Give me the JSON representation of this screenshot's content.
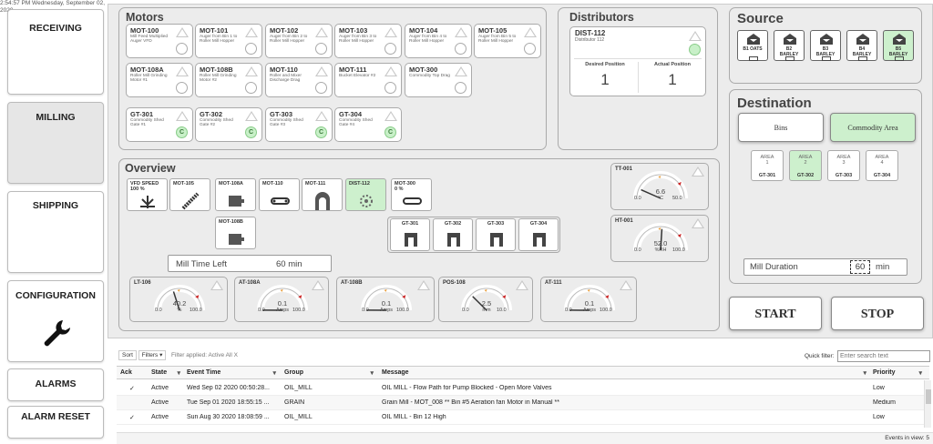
{
  "timestamp": "2:54:57 PM Wednesday, September 02, 2020",
  "nav": {
    "receiving": "RECEIVING",
    "milling": "MILLING",
    "shipping": "SHIPPING",
    "configuration": "CONFIGURATION",
    "alarms": "ALARMS",
    "alarm_reset": "ALARM RESET"
  },
  "motors": {
    "title": "Motors",
    "tiles": [
      {
        "id": "MOT-100",
        "desc": "Mill Feed Multiplied Auger VFD"
      },
      {
        "id": "MOT-101",
        "desc": "Auger from Bin 1 to Roller Mill Hopper"
      },
      {
        "id": "MOT-102",
        "desc": "Auger from Bin 2 to Roller Mill Hopper"
      },
      {
        "id": "MOT-103",
        "desc": "Auger from Bin 3 to Roller Mill Hopper"
      },
      {
        "id": "MOT-104",
        "desc": "Auger from Bin 4 to Roller Mill Hopper"
      },
      {
        "id": "MOT-105",
        "desc": "Auger from Bin 5 to Roller Mill Hopper"
      },
      {
        "id": "MOT-108A",
        "desc": "Roller Mill Grinding Motor #1"
      },
      {
        "id": "MOT-108B",
        "desc": "Roller Mill Grinding Motor #2"
      },
      {
        "id": "MOT-110",
        "desc": "Roller and Mixer Discharge Drag"
      },
      {
        "id": "MOT-111",
        "desc": "Bucket Elevator #2"
      },
      {
        "id": "MOT-300",
        "desc": "Commodity Top Drag"
      },
      {
        "id": "GT-301",
        "desc": "Commodity Shed Gate #1",
        "c": "C"
      },
      {
        "id": "GT-302",
        "desc": "Commodity Shed Gate #2",
        "c": "C"
      },
      {
        "id": "GT-303",
        "desc": "Commodity Shed Gate #3",
        "c": "C"
      },
      {
        "id": "GT-304",
        "desc": "Commodity Shed Gate #4",
        "c": "C"
      }
    ]
  },
  "distributors": {
    "title": "Distributors",
    "id": "DIST-112",
    "desc": "Distributor 112",
    "desired_label": "Desired Position",
    "desired_value": "1",
    "actual_label": "Actual Position",
    "actual_value": "1"
  },
  "overview": {
    "title": "Overview",
    "items": [
      {
        "label": "VFD SPEED",
        "value": "100 %"
      },
      {
        "label": "MOT-105",
        "value": ""
      },
      {
        "label": "MOT-108A",
        "value": ""
      },
      {
        "label": "MOT-110",
        "value": ""
      },
      {
        "label": "MOT-111",
        "value": ""
      },
      {
        "label": "DIST-112",
        "value": ""
      },
      {
        "label": "MOT-300",
        "value": "0 %"
      },
      {
        "label": "MOT-108B",
        "value": ""
      }
    ],
    "gates": [
      "GT-301",
      "GT-302",
      "GT-303",
      "GT-304"
    ],
    "mill_time_label": "Mill Time Left",
    "mill_time_value": "60 min",
    "gauges": [
      {
        "id": "LT-106",
        "value": "40.2",
        "unit": "%",
        "min": "0.0",
        "max": "100.0",
        "fraction": 0.402
      },
      {
        "id": "AT-108A",
        "value": "0.1",
        "unit": "Amps",
        "min": "0.0",
        "max": "100.0",
        "fraction": 0.001
      },
      {
        "id": "AT-108B",
        "value": "0.1",
        "unit": "Amps",
        "min": "0.0",
        "max": "100.0",
        "fraction": 0.001
      },
      {
        "id": "POS-108",
        "value": "2.5",
        "unit": "mm",
        "min": "0.0",
        "max": "10.0",
        "fraction": 0.25
      },
      {
        "id": "AT-111",
        "value": "0.1",
        "unit": "Amps",
        "min": "0.0",
        "max": "100.0",
        "fraction": 0.001
      }
    ],
    "side_gauges": [
      {
        "id": "TT-001",
        "value": "6.6",
        "unit": "°C",
        "min": "0.0",
        "max": "50.0",
        "fraction": 0.132
      },
      {
        "id": "HT-001",
        "value": "52.0",
        "unit": "%RH",
        "min": "0.0",
        "max": "100.0",
        "fraction": 0.52
      }
    ]
  },
  "source": {
    "title": "Source",
    "items": [
      {
        "line1": "B1 OATS",
        "line2": ""
      },
      {
        "line1": "B2",
        "line2": "BARLEY"
      },
      {
        "line1": "B3",
        "line2": "BARLEY"
      },
      {
        "line1": "B4",
        "line2": "BARLEY"
      },
      {
        "line1": "B5",
        "line2": "BARLEY"
      }
    ]
  },
  "destination": {
    "title": "Destination",
    "bins_label": "Bins",
    "commodity_label": "Commodity Area",
    "areas": [
      {
        "name": "AREA",
        "num": "1",
        "gt": "GT-301"
      },
      {
        "name": "AREA",
        "num": "2",
        "gt": "GT-302"
      },
      {
        "name": "AREA",
        "num": "3",
        "gt": "GT-303"
      },
      {
        "name": "AREA",
        "num": "4",
        "gt": "GT-304"
      }
    ],
    "mill_duration_label": "Mill Duration",
    "mill_duration_value": "60",
    "mill_duration_unit": "min"
  },
  "start_label": "START",
  "stop_label": "STOP",
  "alarms": {
    "sort_label": "Sort",
    "filters_label": "Filters ▾",
    "filter_applied": "Filter applied: Active All X",
    "quick_filter_label": "Quick filter:",
    "quick_filter_placeholder": "Enter search text",
    "columns": [
      "Ack",
      "State",
      "Event Time",
      "Group",
      "Message",
      "Priority"
    ],
    "rows": [
      {
        "ack": "✓",
        "state": "Active",
        "time": "Wed Sep 02 2020 00:50:28...",
        "group": "OIL_MILL",
        "message": "OIL MILL - Flow Path for Pump Blocked - Open More Valves",
        "priority": "Low"
      },
      {
        "ack": "",
        "state": "Active",
        "time": "Tue Sep 01 2020 18:55:15 ...",
        "group": "GRAIN",
        "message": "Grain Mill - MOT_008 ** Bin #5 Aeration fan  Motor in Manual **",
        "priority": "Medium"
      },
      {
        "ack": "✓",
        "state": "Active",
        "time": "Sun Aug 30 2020 18:08:59 ...",
        "group": "OIL_MILL",
        "message": "OIL MILL - Bin 12 High",
        "priority": "Low"
      }
    ],
    "events_in_view": "Events in view: 5"
  },
  "colors": {
    "selected": "#cdf0cd",
    "panel": "#ececec",
    "needle": "#333",
    "marker": "#cc2222"
  }
}
